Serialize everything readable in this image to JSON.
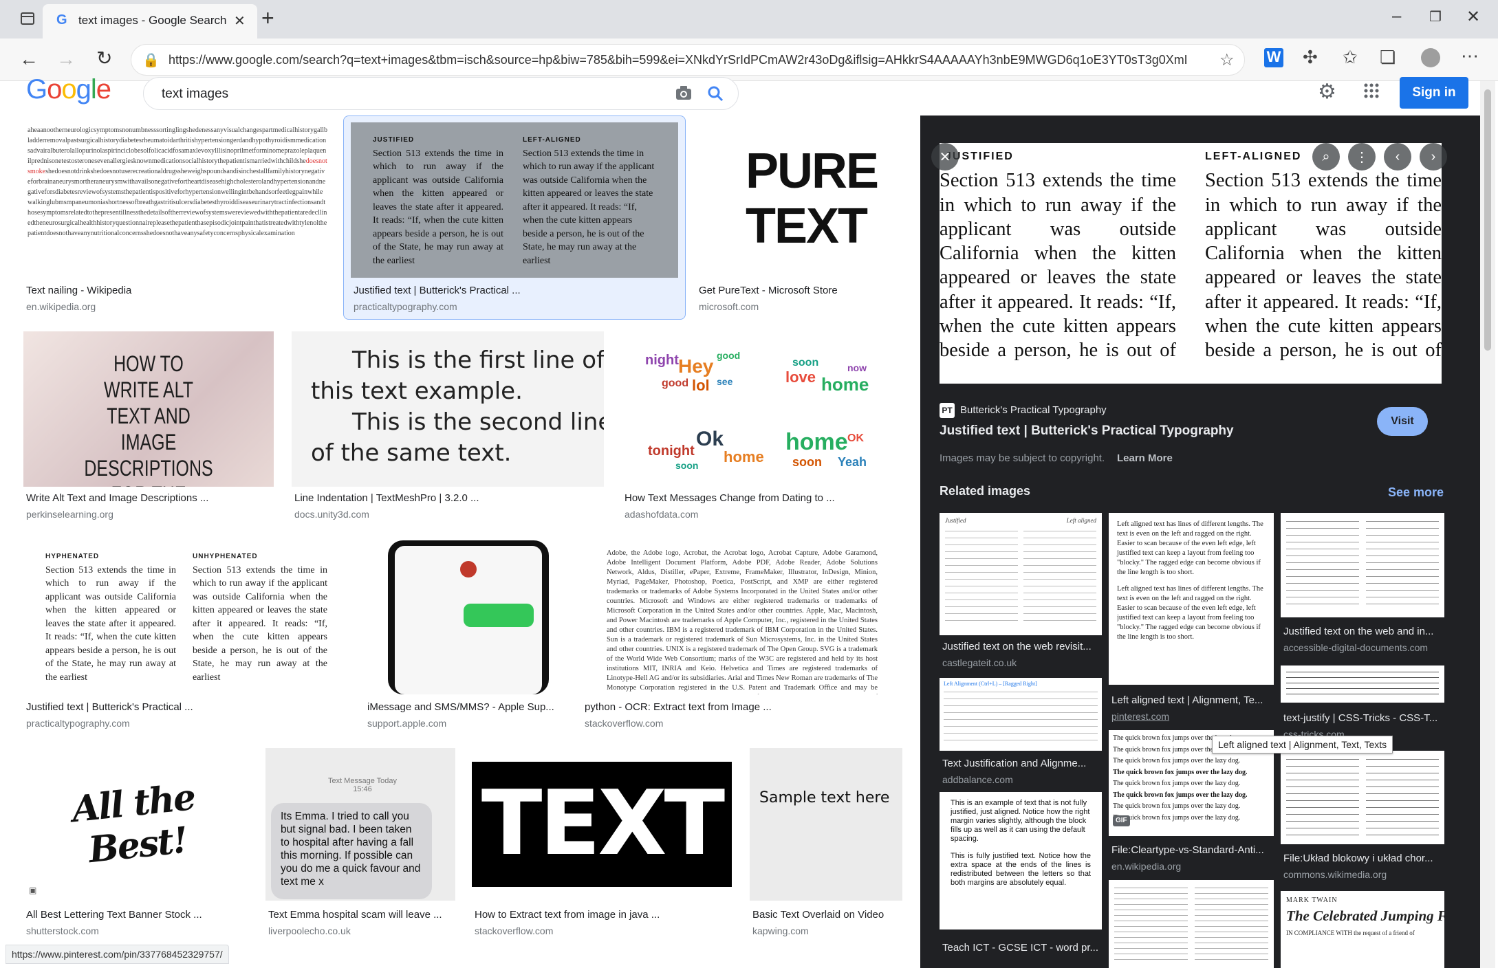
{
  "browser": {
    "tab_title": "text images - Google Search",
    "tab_close": "✕",
    "new_tab": "+",
    "url": "https://www.google.com/search?q=text+images&tbm=isch&source=hp&biw=785&bih=599&ei=XNkdYrSrIdPCmAW2r43oDg&iflsig=AHkkrS4AAAAAYh3nbE9MWGD6q1oE3YT0sT3g0XmLKuBc&...",
    "status_url": "https://www.pinterest.com/pin/337768452329757/"
  },
  "google": {
    "logo": "Google",
    "query": "text images",
    "sign_in": "Sign in"
  },
  "results": [
    {
      "title": "Text nailing - Wikipedia",
      "site": "en.wikipedia.org"
    },
    {
      "title": "Justified text | Butterick's Practical ...",
      "site": "practicaltypography.com"
    },
    {
      "title": "Get PureText - Microsoft Store",
      "site": "microsoft.com"
    },
    {
      "title": "Write Alt Text and Image Descriptions ...",
      "site": "perkinselearning.org"
    },
    {
      "title": "Line Indentation | TextMeshPro | 3.2.0 ...",
      "site": "docs.unity3d.com"
    },
    {
      "title": "How Text Messages Change from Dating to ...",
      "site": "adashofdata.com"
    },
    {
      "title": "Justified text | Butterick's Practical ...",
      "site": "practicaltypography.com"
    },
    {
      "title": "iMessage and SMS/MMS? - Apple Sup...",
      "site": "support.apple.com"
    },
    {
      "title": "python - OCR: Extract text from Image ...",
      "site": "stackoverflow.com"
    },
    {
      "title": "All Best Lettering Text Banner Stock ...",
      "site": "shutterstock.com"
    },
    {
      "title": "Text Emma hospital scam will leave ...",
      "site": "liverpoolecho.co.uk"
    },
    {
      "title": "How to Extract text from image in java ...",
      "site": "stackoverflow.com"
    },
    {
      "title": "Basic Text Overlaid on Video",
      "site": "kapwing.com"
    }
  ],
  "thumbs": {
    "pure1": "PURE",
    "pure2": "TEXT",
    "alt_text": "HOW TO WRITE ALT TEXT AND IMAGE DESCRIPTIONS FOR THE VISUALLY IMPAIRED",
    "line1": "This is the first line of",
    "line2": "this text example.",
    "line3": "This is the second line",
    "line4": "of the same text.",
    "big_text": "TEXT",
    "sample": "Sample text here",
    "allbest": "All the Best!",
    "emma_header": "Text Message Today 15:46",
    "emma_msg": "Its Emma. I tried to call you but signal bad. I been taken to hospital after having a fall this morning. If possible can you do me a quick favour and text me x",
    "justified_label": "JUSTIFIED",
    "left_label": "LEFT-ALIGNED",
    "hyph_label": "HYPHENATED",
    "unhyph_label": "UNHYPHENATED",
    "para": "Section 513 extends the time in which to run away if the applicant was outside California when the kitten appeared or leaves the state after it appeared. It reads: “If, when the cute kitten appears beside a person, he is out of the State, he may run away at the earliest"
  },
  "panel": {
    "source_name": "Butterick's Practical Typography",
    "source_logo": "PT",
    "title": "Justified text | Butterick's Practical Typography",
    "visit": "Visit",
    "copyright": "Images may be subject to copyright.",
    "learn_more": "Learn More",
    "related_header": "Related images",
    "see_more": "See more",
    "tooltip": "Left aligned text | Alignment, Text, Texts",
    "preview_left": "JUSTIFIED",
    "preview_right": "LEFT-ALIGNED"
  },
  "related": [
    {
      "title": "Justified text on the web revisit...",
      "site": "castlegateit.co.uk"
    },
    {
      "title": "Left aligned text | Alignment, Te...",
      "site": "pinterest.com"
    },
    {
      "title": "Justified text on the web and in...",
      "site": "accessible-digital-documents.com"
    },
    {
      "title": "text-justify | CSS-Tricks - CSS-T...",
      "site": "css-tricks.com"
    },
    {
      "title": "Text Justification and Alignme...",
      "site": "addbalance.com"
    },
    {
      "title": "File:Cleartype-vs-Standard-Anti...",
      "site": "en.wikipedia.org"
    },
    {
      "title": "File:Układ blokowy i układ chor...",
      "site": "commons.wikimedia.org"
    },
    {
      "title": "Teach ICT - GCSE ICT - word pr...",
      "site": ""
    }
  ],
  "related_thumbs": {
    "r1_left": "Justified",
    "r1_right": "Left aligned",
    "r2_text": "Left aligned text has lines of different lengths. The text is even on the left and ragged on the right. Easier to scan because of the even left edge, left justified text can keep a layout from feeling too \"blocky.\" The ragged edge can become obvious if the line length is too short.",
    "r4_head": "Left Alignment (Ctrl+L) – [Ragged Right]",
    "r5_text": "This is an example of text that is not fully justified, just aligned. Notice how the right margin varies slightly, although the block fills up as well as it can using the default spacing.",
    "r5_text2": "This is fully justified text. Notice how the extra space at the ends of the lines is redistributed between the letters so that both margins are absolutely equal.",
    "fox": "The quick brown fox jumps over the lazy dog.",
    "gif": "GIF",
    "twain": "MARK TWAIN",
    "frog": "The Celebrated Jumping Frog of Calaveras County",
    "compliance": "IN COMPLIANCE WITH the request of a friend of"
  }
}
